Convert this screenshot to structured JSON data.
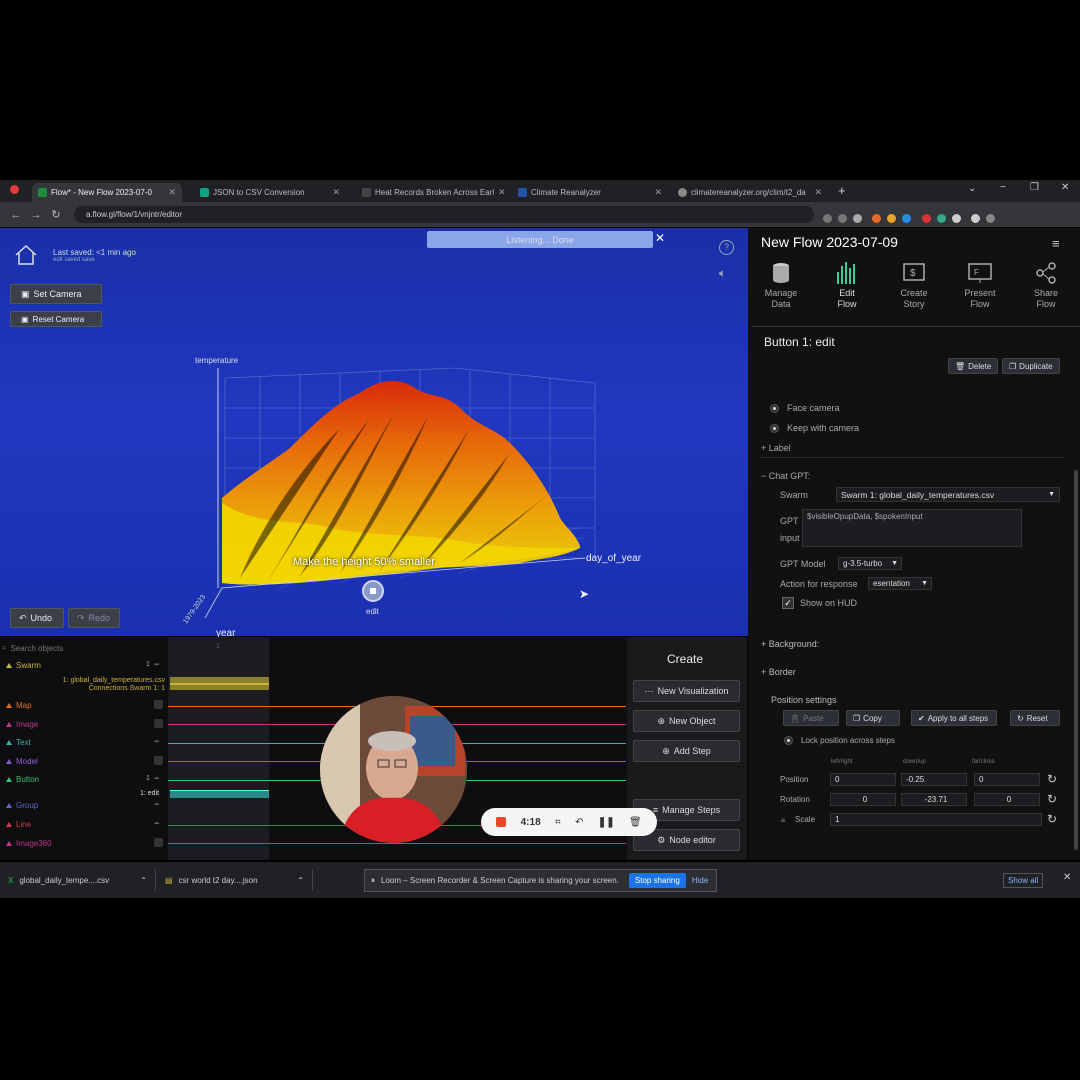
{
  "browser": {
    "tabs": [
      {
        "title": "Flow* - New Flow 2023-07-0",
        "icon_color": "#1e8e3e",
        "active": true
      },
      {
        "title": "JSON to CSV Conversion",
        "icon_color": "#10a37f"
      },
      {
        "title": "Heat Records Broken Across Earl",
        "icon_color": "#444"
      },
      {
        "title": "Climate Reanalyzer",
        "icon_color": "#2255aa"
      },
      {
        "title": "climatereanalyzer.org/clim/t2_da",
        "icon_color": "#888"
      }
    ],
    "new_tab": "+",
    "url": "a.flow.gl/flow/1/vnjntr/editor",
    "nav": {
      "back": "←",
      "forward": "→",
      "reload": "C"
    }
  },
  "viewport": {
    "last_saved": "Last saved: <1 min ago",
    "save_sub": "edit saved save",
    "set_camera": "Set Camera",
    "reset_camera": "Reset Camera",
    "listening": "Listening... Done",
    "caption": "Make the height 50% smaller.",
    "edit_label": "edit",
    "undo": "Undo",
    "redo": "Redo",
    "axis_temperature": "temperature",
    "axis_day": "day_of_year",
    "axis_year": "year",
    "year_ticks": "1979-2023",
    "surface_colors": [
      "#f5d800",
      "#f7a000",
      "#f26200",
      "#e02a00"
    ],
    "bg_color": "#1e36b8"
  },
  "panel": {
    "title": "New Flow 2023-07-09",
    "toolbar": [
      {
        "label": "Manage\nData",
        "icon": "database-icon"
      },
      {
        "label": "Edit\nFlow",
        "icon": "bars-icon"
      },
      {
        "label": "Create\nStory",
        "icon": "story-icon"
      },
      {
        "label": "Present\nFlow",
        "icon": "present-icon"
      },
      {
        "label": "Share\nFlow",
        "icon": "share-icon"
      }
    ],
    "section_title": "Button 1: edit",
    "delete": "Delete",
    "duplicate": "Duplicate",
    "face_camera": "Face camera",
    "keep_with_camera": "Keep with camera",
    "label_section": "+ Label",
    "chatgpt_section": "− Chat GPT:",
    "swarm_label": "Swarm",
    "swarm_value": "Swarm 1: global_daily_temperatures.csv",
    "gpt_label": "GPT",
    "input_label": "input",
    "gpt_input_value": "$visibleOpupData, $spokenInput",
    "gpt_model_label": "GPT Model",
    "gpt_model_value": "g-3.5-turbo",
    "action_label": "Action for response",
    "action_value": "esentation",
    "show_hud": "Show on HUD",
    "background_section": "+ Background:",
    "border_section": "+ Border",
    "position_settings": "Position settings",
    "paste": "Paste",
    "copy": "Copy",
    "apply_all": "Apply to all steps",
    "reset": "Reset",
    "lock_position": "Lock position across steps",
    "col_left_right": "left/right",
    "col_down_up": "down/up",
    "col_far_close": "far/close",
    "position_label": "Position",
    "position_values": [
      "0",
      "-0.25",
      "0"
    ],
    "rotation_label": "Rotation",
    "rotation_values": [
      "0",
      "-23.71",
      "0"
    ],
    "scale_label": "Scale",
    "scale_value": "1"
  },
  "timeline": {
    "search_placeholder": "Search objects",
    "items": [
      {
        "label": "Swarm",
        "color": "#c9b53a",
        "count": "1"
      },
      {
        "label": "Map",
        "color": "#e0701a"
      },
      {
        "label": "Image",
        "color": "#c0398a"
      },
      {
        "label": "Text",
        "color": "#3ab0b0"
      },
      {
        "label": "Model",
        "color": "#8a5ac8"
      },
      {
        "label": "Button",
        "color": "#3ac070",
        "count": "1"
      },
      {
        "label": "Group",
        "color": "#5a6ac8"
      },
      {
        "label": "Line",
        "color": "#d03a4a"
      },
      {
        "label": "Image360",
        "color": "#c0398a"
      }
    ],
    "swarm_sub": "1: global_daily_temperatures.csv",
    "swarm_conn": "Connections Swarm 1: 1",
    "button_sub": "1: edit",
    "step_number": "1"
  },
  "create": {
    "title": "Create",
    "new_visualization": "New Visualization",
    "new_object": "New Object",
    "add_step": "Add Step",
    "manage_steps": "Manage Steps",
    "node_editor": "Node editor"
  },
  "recorder": {
    "time": "4:18"
  },
  "downloads": {
    "items": [
      "global_daily_tempe....csv",
      "csr world t2 day....json"
    ],
    "show_all": "Show all"
  },
  "loom": {
    "message": "Loom – Screen Recorder & Screen Capture is sharing your screen.",
    "stop": "Stop sharing",
    "hide": "Hide"
  }
}
